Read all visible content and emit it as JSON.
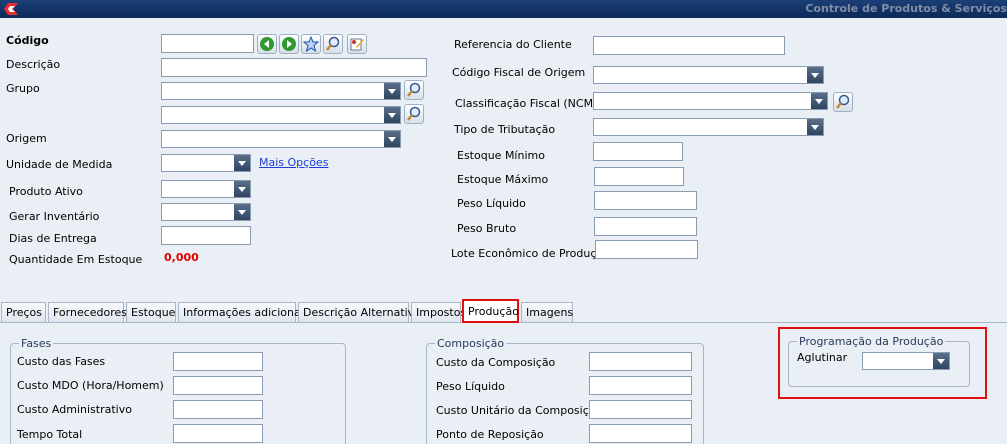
{
  "window": {
    "title": "Controle de Produtos & Serviços"
  },
  "left": {
    "codigo": "Código",
    "descricao": "Descrição",
    "grupo": "Grupo",
    "origem": "Origem",
    "unidade_medida": "Unidade de Medida",
    "mais_opcoes": "Mais Opções",
    "produto_ativo": "Produto Ativo",
    "gerar_inventario": "Gerar Inventário",
    "dias_entrega": "Dias de Entrega",
    "quantidade_estoque": "Quantidade Em Estoque",
    "quantidade_valor": "0,000"
  },
  "right": {
    "referencia_cliente": "Referencia do Cliente",
    "codigo_fiscal_origem": "Código Fiscal de Origem",
    "classificacao_fiscal": "Classificação Fiscal (NCM)",
    "tipo_tributacao": "Tipo de Tributação",
    "estoque_minimo": "Estoque Mínimo",
    "estoque_maximo": "Estoque Máximo",
    "peso_liquido": "Peso Líquido",
    "peso_bruto": "Peso Bruto",
    "lote_economico": "Lote Econômico de Produção"
  },
  "tabs": [
    {
      "label": "Preços"
    },
    {
      "label": "Fornecedores"
    },
    {
      "label": "Estoque"
    },
    {
      "label": "Informações adicionais"
    },
    {
      "label": "Descrição Alternativa"
    },
    {
      "label": "Impostos"
    },
    {
      "label": "Produção"
    },
    {
      "label": "Imagens"
    }
  ],
  "fases": {
    "legend": "Fases",
    "custo_fases": "Custo das Fases",
    "custo_mdo": "Custo MDO (Hora/Homem)",
    "custo_administrativo": "Custo Administrativo",
    "tempo_total": "Tempo Total"
  },
  "composicao": {
    "legend": "Composição",
    "custo_composicao": "Custo da Composição",
    "peso_liquido": "Peso Líquido",
    "custo_unitario": "Custo Unitário da Composição",
    "ponto_reposicao": "Ponto de Reposição"
  },
  "programacao": {
    "legend": "Programação da Produção",
    "aglutinar": "Aglutinar"
  },
  "colors": {
    "accent_red": "#e01010",
    "titlebar": "#0c2a5a"
  },
  "icons": [
    "app-logo-icon",
    "previous-icon",
    "next-icon",
    "star-icon",
    "search-icon",
    "edit-icon"
  ]
}
